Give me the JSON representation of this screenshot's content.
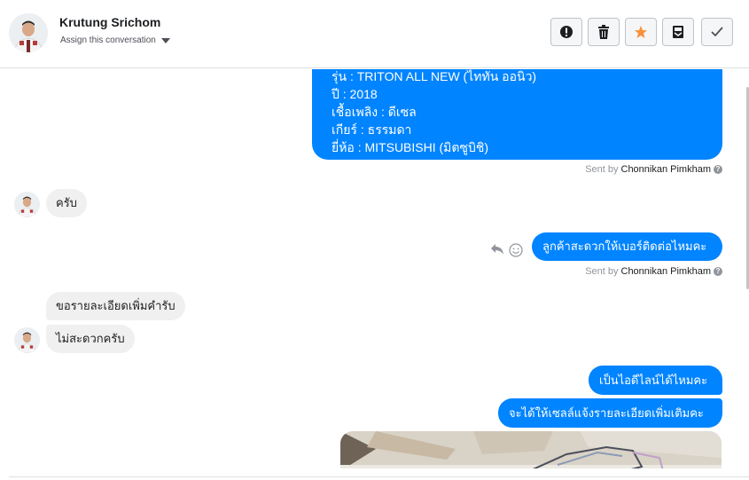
{
  "header": {
    "contact_name": "Krutung Srichom",
    "assign_label": "Assign this conversation",
    "actions": [
      {
        "icon": "alert-icon",
        "label": "Mark as spam"
      },
      {
        "icon": "trash-icon",
        "label": "Delete"
      },
      {
        "icon": "star-icon",
        "label": "Star",
        "color": "#f7923b"
      },
      {
        "icon": "archive-icon",
        "label": "Archive"
      },
      {
        "icon": "check-icon",
        "label": "Mark as done"
      }
    ]
  },
  "thread": {
    "vehicle_info": {
      "lines": [
        "รุ่น : TRITON ALL NEW (ไททัน ออนิว)",
        "ปี : 2018",
        "เชื้อเพลิง : ดีเซล",
        "เกียร์ : ธรรมดา",
        "ยี่ห้อ : MITSUBISHI (มิตซูบิชิ)"
      ],
      "sent_by_prefix": "Sent by",
      "sent_by_name": "Chonnikan Pimkham"
    },
    "incoming_1": "ครับ",
    "outgoing_1": {
      "text": "ลูกค้าสะดวกให้เบอร์ติดต่อไหมคะ",
      "sent_by_prefix": "Sent by",
      "sent_by_name": "Chonnikan Pimkham"
    },
    "incoming_2": "ขอรายละเอียดเพิ่มคำรับ",
    "incoming_3": "ไม่สะดวกครับ",
    "outgoing_2": "เป็นไอดีไลน์ได้ไหมคะ",
    "outgoing_3": "จะได้ให้เซลล์แจ้งรายละเอียดเพิ่มเติมคะ"
  },
  "colors": {
    "outgoing_bubble": "#0084ff",
    "incoming_bubble": "#f1f0f0",
    "star": "#f7923b"
  }
}
